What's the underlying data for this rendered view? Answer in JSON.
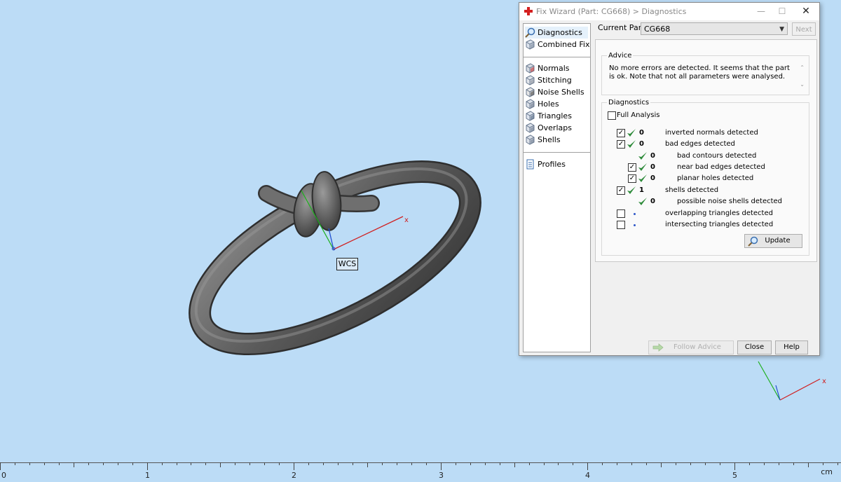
{
  "viewport": {
    "wcs_label": "WCS",
    "axis_label": "x",
    "corner_axis_label": "x"
  },
  "ruler": {
    "labels": [
      "0",
      "1",
      "2",
      "3",
      "4",
      "5"
    ],
    "unit": "cm"
  },
  "dialog": {
    "title": "Fix Wizard (Part: CG668) > Diagnostics",
    "nav": [
      {
        "label": "Diagnostics",
        "icon": "magnifier-icon",
        "selected": true
      },
      {
        "label": "Combined Fix",
        "icon": "cube-icon"
      },
      {
        "label": "Normals",
        "icon": "normals-icon"
      },
      {
        "label": "Stitching",
        "icon": "stitching-icon"
      },
      {
        "label": "Noise Shells",
        "icon": "noise-shells-icon"
      },
      {
        "label": "Holes",
        "icon": "holes-icon"
      },
      {
        "label": "Triangles",
        "icon": "triangles-icon"
      },
      {
        "label": "Overlaps",
        "icon": "overlaps-icon"
      },
      {
        "label": "Shells",
        "icon": "shells-icon"
      },
      {
        "label": "Profiles",
        "icon": "document-icon"
      }
    ],
    "current_part_label": "Current Part:",
    "current_part_value": "CG668",
    "next_label": "Next",
    "advice_title": "Advice",
    "advice_text": "No more errors are detected. It seems that the part is ok. Note that not all parameters were analysed.",
    "diagnostics_title": "Diagnostics",
    "full_analysis_label": "Full Analysis",
    "full_analysis_checked": false,
    "rows": [
      {
        "checked": true,
        "status": "ok",
        "count": "0",
        "label": "inverted normals detected",
        "indent": 0
      },
      {
        "checked": true,
        "status": "ok",
        "count": "0",
        "label": "bad edges detected",
        "indent": 0
      },
      {
        "checked": null,
        "status": "ok",
        "count": "0",
        "label": "bad contours detected",
        "indent": 1
      },
      {
        "checked": true,
        "status": "ok",
        "count": "0",
        "label": "near bad edges detected",
        "indent": 1
      },
      {
        "checked": true,
        "status": "ok",
        "count": "0",
        "label": "planar holes detected",
        "indent": 1
      },
      {
        "checked": true,
        "status": "ok",
        "count": "1",
        "label": "shells detected",
        "indent": 0
      },
      {
        "checked": null,
        "status": "ok",
        "count": "0",
        "label": "possible noise shells detected",
        "indent": 1
      },
      {
        "checked": false,
        "status": "none",
        "count": "",
        "label": "overlapping triangles detected",
        "indent": 0
      },
      {
        "checked": false,
        "status": "none",
        "count": "",
        "label": "intersecting triangles detected",
        "indent": 0
      }
    ],
    "update_label": "Update",
    "follow_advice_label": "Follow Advice",
    "close_label": "Close",
    "help_label": "Help"
  },
  "colors": {
    "background": "#bcdcf6",
    "check_green": "#2e8b3a",
    "x_axis": "#d02020",
    "y_axis": "#20b020",
    "z_axis": "#2050d0"
  }
}
